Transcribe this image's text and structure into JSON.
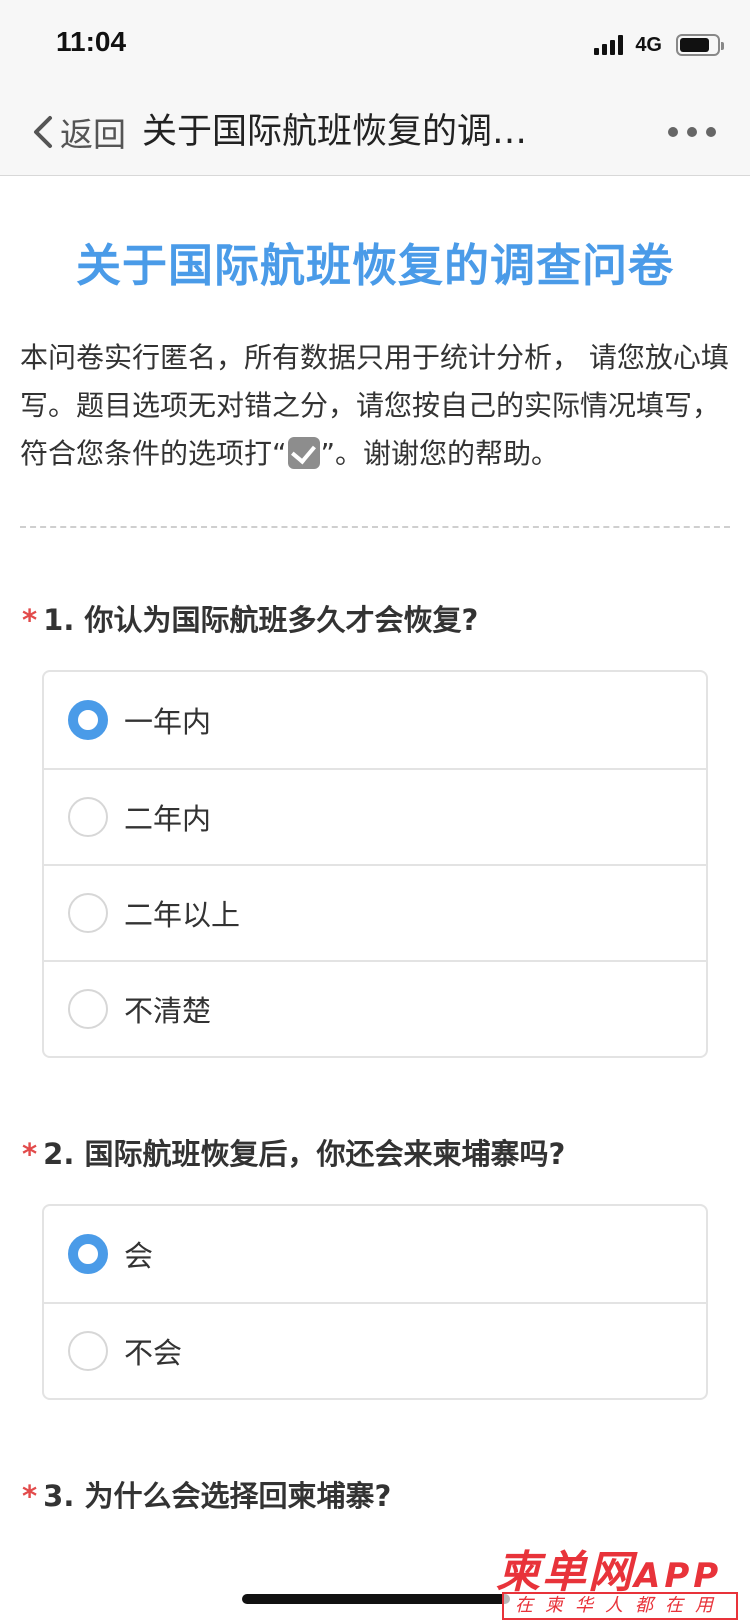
{
  "status_bar": {
    "time": "11:04",
    "network": "4G",
    "battery_level": 0.8
  },
  "nav": {
    "back_label": "返回",
    "title": "关于国际航班恢复的调…",
    "back_icon": "chevron-left-icon",
    "more_icon": "more-dots-icon"
  },
  "survey": {
    "title": "关于国际航班恢复的调查问卷",
    "desc_before_icon": "本问卷实行匿名，所有数据只用于统计分析， 请您放心填写。题目选项无对错之分，请您按自己的实际情况填写，符合您条件的选项打“",
    "desc_icon": "check-box-icon",
    "desc_after_icon": "”。谢谢您的帮助。"
  },
  "questions": [
    {
      "required_mark": "*",
      "title": "1. 你认为国际航班多久才会恢复?",
      "options": [
        {
          "label": "一年内",
          "selected": true
        },
        {
          "label": "二年内",
          "selected": false
        },
        {
          "label": "二年以上",
          "selected": false
        },
        {
          "label": "不清楚",
          "selected": false
        }
      ]
    },
    {
      "required_mark": "*",
      "title": "2. 国际航班恢复后，你还会来柬埔寨吗?",
      "options": [
        {
          "label": "会",
          "selected": true
        },
        {
          "label": "不会",
          "selected": false
        }
      ]
    },
    {
      "required_mark": "*",
      "title": "3. 为什么会选择回柬埔寨?",
      "options": []
    }
  ],
  "watermark": {
    "brand": "柬单网",
    "suffix": "APP",
    "tagline": "在柬华人都在用"
  },
  "colors": {
    "accent": "#4a9be8",
    "required": "#e24b4b",
    "watermark": "#e8333a"
  }
}
